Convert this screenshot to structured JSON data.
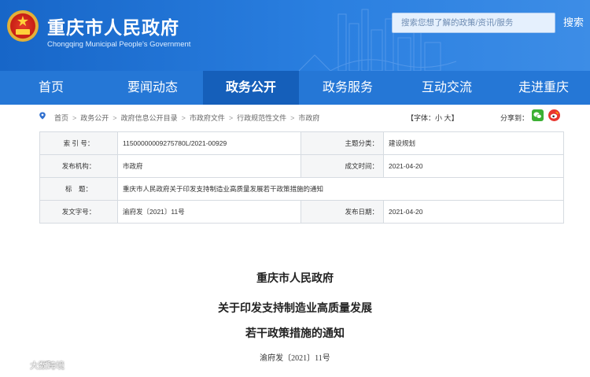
{
  "header": {
    "title": "重庆市人民政府",
    "subtitle": "Chongqing Municipal People's Government",
    "search_placeholder": "搜索您想了解的政策/资讯/服务",
    "search_button": "搜索"
  },
  "nav": {
    "items": [
      {
        "label": "首页"
      },
      {
        "label": "要闻动态"
      },
      {
        "label": "政务公开",
        "active": true
      },
      {
        "label": "政务服务"
      },
      {
        "label": "互动交流"
      },
      {
        "label": "走进重庆"
      }
    ]
  },
  "breadcrumb": {
    "items": [
      "首页",
      "政务公开",
      "政府信息公开目录",
      "市政府文件",
      "行政规范性文件",
      "市政府"
    ],
    "separator": ">",
    "font_label": "【字体：",
    "font_small": "小",
    "font_large": "大",
    "font_end": "】",
    "share_label": "分享到："
  },
  "info": {
    "index_label": "索 引 号：",
    "index_value": "11500000009275780L/2021-00929",
    "theme_label": "主题分类：",
    "theme_value": "建设规划",
    "issuer_label": "发布机构：",
    "issuer_value": "市政府",
    "created_label": "成文时间：",
    "created_value": "2021-04-20",
    "title_label": "标　题：",
    "title_value": "重庆市人民政府关于印发支持制造业高质量发展若干政策措施的通知",
    "docno_label": "发文字号：",
    "docno_value": "渝府发〔2021〕11号",
    "published_label": "发布日期：",
    "published_value": "2021-04-20"
  },
  "document": {
    "issuer": "重庆市人民政府",
    "title_line1": "关于印发支持制造业高质量发展",
    "title_line2": "若干政策措施的通知",
    "doc_number": "渝府发〔2021〕11号"
  },
  "watermark": {
    "text": "大数跨境"
  },
  "colors": {
    "header_blue": "#1766c8",
    "nav_blue": "#2577d6",
    "nav_active": "#155fba"
  }
}
